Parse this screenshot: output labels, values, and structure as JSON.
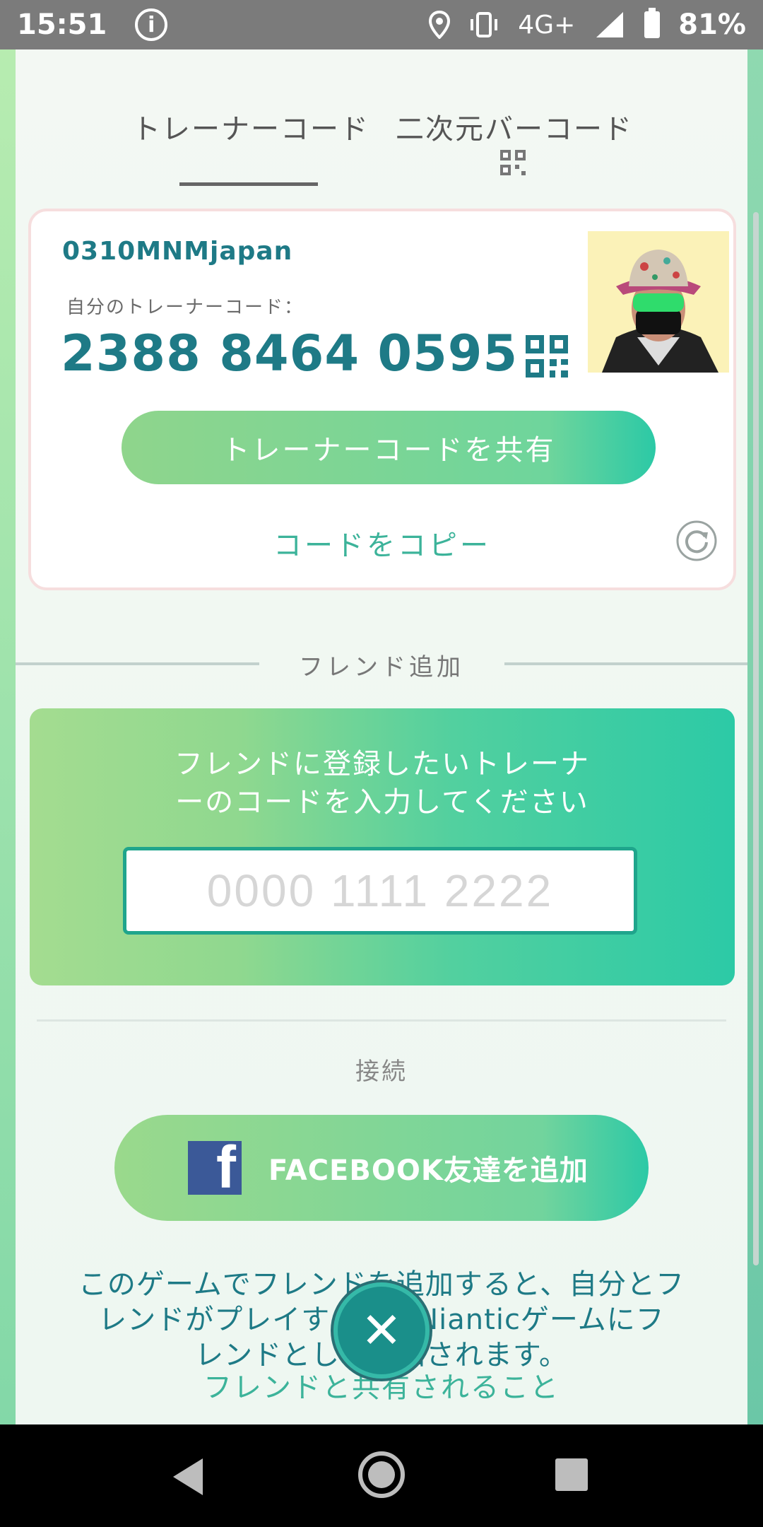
{
  "status_bar": {
    "time": "15:51",
    "network": "4G+",
    "battery": "81%",
    "icons": [
      "info-icon",
      "location-icon",
      "vibrate-icon",
      "signal-icon",
      "battery-icon"
    ]
  },
  "tabs": [
    {
      "label": "トレーナーコード",
      "active": true
    },
    {
      "label": "二次元バーコード",
      "active": false
    }
  ],
  "card": {
    "trainer_name": "0310MNMjapan",
    "code_label": "自分のトレーナーコード：",
    "code_value": "2388 8464 0595",
    "share_label": "トレーナーコードを共有",
    "copy_label": "コードをコピー"
  },
  "add_friend": {
    "section_title": "フレンド追加",
    "instruction_line1": "フレンドに登録したいトレーナ",
    "instruction_line2": "ーのコードを入力してください",
    "input_placeholder": "0000 1111 2222"
  },
  "connect": {
    "label": "接続",
    "facebook_label": "FACEBOOK友達を追加"
  },
  "info": {
    "text_line1": "このゲームでフレンドを追加すると、自分とフ",
    "text_line2": "レンドがプレイする他のNianticゲームにフ",
    "text_line3": "レンドとして追加されます。",
    "shared_link": "フレンドと共有されること"
  },
  "colors": {
    "accent": "#1e7a86",
    "green_start": "#8fd58c",
    "green_end": "#2cc9a6",
    "link": "#3cb39a"
  }
}
